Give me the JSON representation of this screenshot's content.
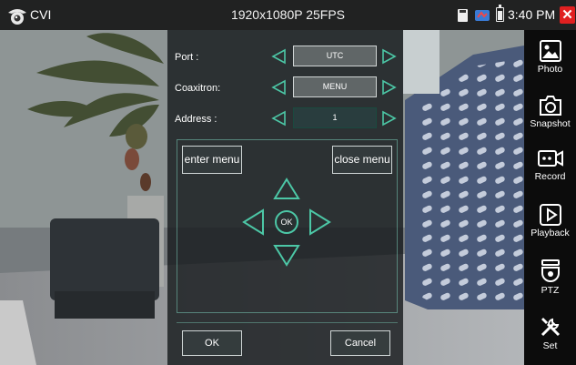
{
  "topbar": {
    "app_name": "CVI",
    "resolution": "1920x1080P 25FPS",
    "time": "3:40 PM",
    "close_symbol": "✕",
    "close_color": "#e02020"
  },
  "panel": {
    "port": {
      "label": "Port :",
      "value": "UTC"
    },
    "coaxitron": {
      "label": "Coaxitron:",
      "value": "MENU"
    },
    "address": {
      "label": "Address :",
      "value": "1"
    },
    "enter_menu": "enter menu",
    "close_menu": "close menu",
    "center_ok": "OK",
    "ok": "OK",
    "cancel": "Cancel",
    "accent_color": "#4cc7a6"
  },
  "sidebar": {
    "items": [
      {
        "label": "Photo",
        "icon": "photo-icon"
      },
      {
        "label": "Snapshot",
        "icon": "camera-icon"
      },
      {
        "label": "Record",
        "icon": "record-icon"
      },
      {
        "label": "Playback",
        "icon": "playback-icon"
      },
      {
        "label": "PTZ",
        "icon": "ptz-camera-icon"
      },
      {
        "label": "Set",
        "icon": "tools-icon"
      }
    ]
  }
}
